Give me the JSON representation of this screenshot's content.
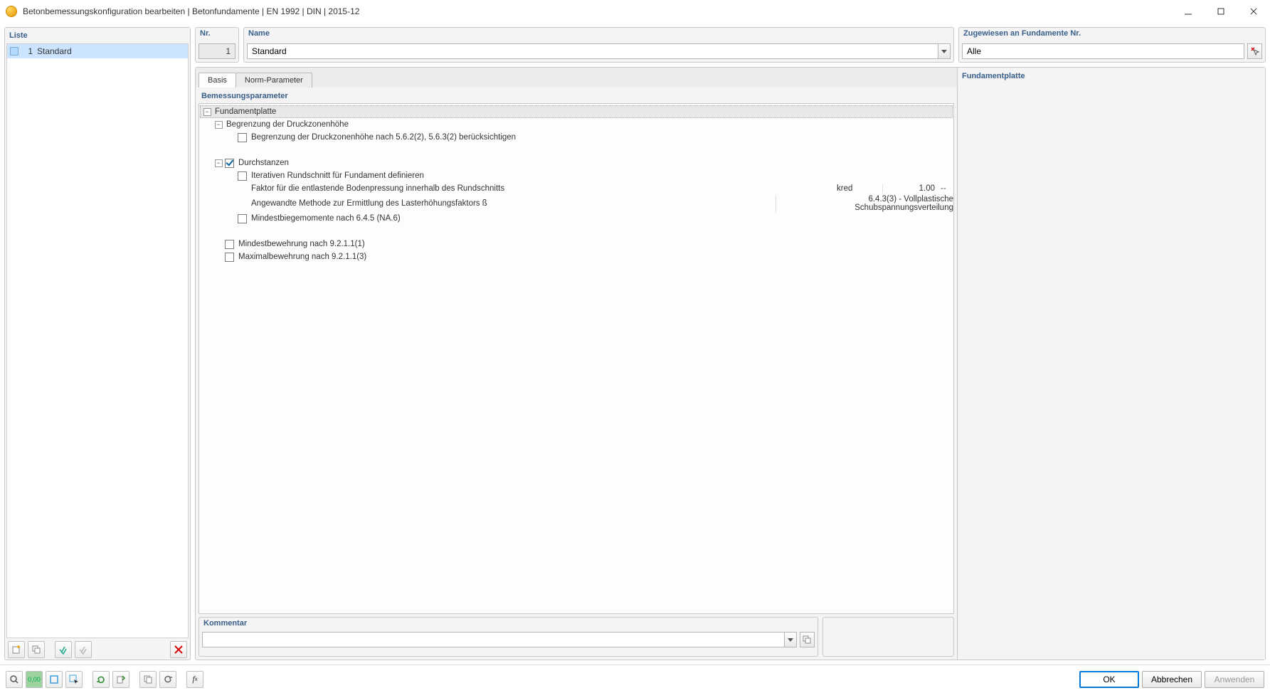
{
  "window": {
    "title": "Betonbemessungskonfiguration bearbeiten | Betonfundamente | EN 1992 | DIN | 2015-12"
  },
  "left": {
    "header": "Liste",
    "items": [
      {
        "num": "1",
        "name": "Standard"
      }
    ]
  },
  "header_row": {
    "nr_label": "Nr.",
    "nr_value": "1",
    "name_label": "Name",
    "name_value": "Standard",
    "assign_label": "Zugewiesen an Fundamente Nr.",
    "assign_value": "Alle"
  },
  "tabs": {
    "basis": "Basis",
    "norm": "Norm-Parameter"
  },
  "section": {
    "title": "Bemessungsparameter"
  },
  "tree": {
    "root": "Fundamentplatte",
    "group_druck": "Begrenzung der Druckzonenhöhe",
    "druck_item": "Begrenzung der Druckzonenhöhe nach 5.6.2(2), 5.6.3(2) berücksichtigen",
    "group_durch": "Durchstanzen",
    "durch_iter": "Iterativen Rundschnitt für Fundament definieren",
    "durch_faktor": "Faktor für die entlastende Bodenpressung innerhalb des Rundschnitts",
    "durch_faktor_sym": "kred",
    "durch_faktor_val": "1.00",
    "durch_faktor_unit": "--",
    "durch_methode": "Angewandte Methode zur Ermittlung des Lasterhöhungsfaktors ß",
    "durch_methode_val": "6.4.3(3) - Vollplastische Schubspannungsverteilung",
    "durch_mindestbiege": "Mindestbiegemomente nach 6.4.5 (NA.6)",
    "mindestbew": "Mindestbewehrung nach 9.2.1.1(1)",
    "maxbew": "Maximalbewehrung nach 9.2.1.1(3)"
  },
  "info_panel": {
    "title": "Fundamentplatte"
  },
  "comment": {
    "label": "Kommentar",
    "value": ""
  },
  "buttons": {
    "ok": "OK",
    "cancel": "Abbrechen",
    "apply": "Anwenden"
  },
  "bottom_icons": {
    "b1": "0,00"
  }
}
